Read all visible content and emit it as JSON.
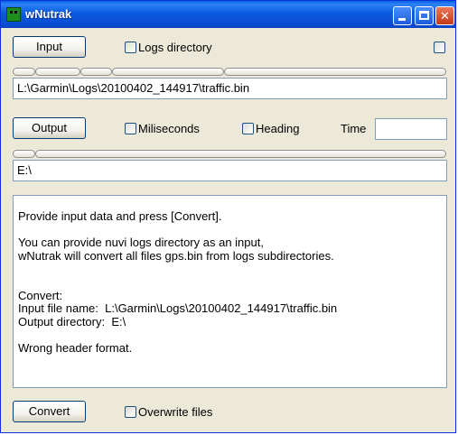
{
  "window": {
    "title": "wNutrak",
    "minimize_glyph": "",
    "close_glyph": "✕"
  },
  "input_section": {
    "button_label": "Input",
    "logs_directory_label": "Logs directory",
    "logs_directory_checked": false,
    "extra_checkbox_checked": false,
    "path_value": "L:\\Garmin\\Logs\\20100402_144917\\traffic.bin",
    "path_segments": 5
  },
  "output_section": {
    "button_label": "Output",
    "miliseconds_label": "Miliseconds",
    "miliseconds_checked": false,
    "heading_label": "Heading",
    "heading_checked": false,
    "time_label": "Time",
    "time_value": "",
    "path_value": "E:\\",
    "path_segments": 1
  },
  "log": {
    "text": "Provide input data and press [Convert].\n\nYou can provide nuvi logs directory as an input,\nwNutrak will convert all files gps.bin from logs subdirectories.\n\n\nConvert:\nInput file name:  L:\\Garmin\\Logs\\20100402_144917\\traffic.bin\nOutput directory:  E:\\\n\nWrong header format."
  },
  "footer": {
    "convert_label": "Convert",
    "overwrite_label": "Overwrite files",
    "overwrite_checked": false
  },
  "colors": {
    "titlebar": "#0a55dd",
    "window_bg": "#ece9d8",
    "field_border": "#7f9db9",
    "close_button": "#c4391a"
  }
}
